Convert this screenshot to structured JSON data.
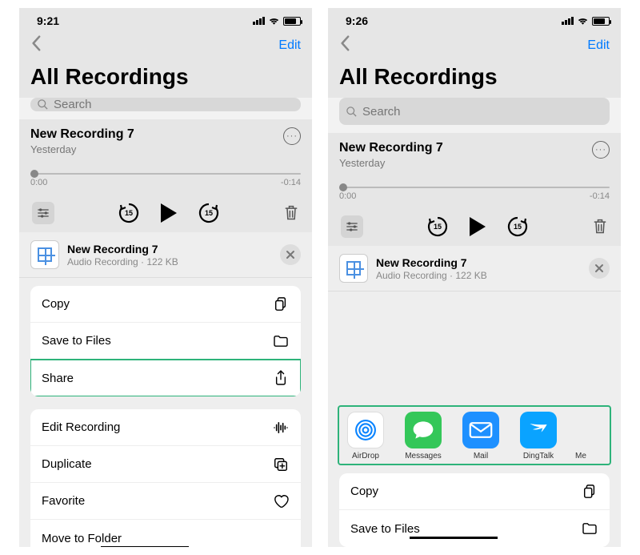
{
  "screens": {
    "left": {
      "status": {
        "time": "9:21"
      },
      "nav": {
        "edit": "Edit"
      },
      "title": "All Recordings",
      "search": {
        "placeholder": "Search"
      },
      "recording": {
        "title": "New Recording 7",
        "subtitle": "Yesterday",
        "start": "0:00",
        "end": "-0:14"
      },
      "share": {
        "title": "New Recording 7",
        "subtitle": "Audio Recording · 122 KB"
      },
      "actions": {
        "copy": "Copy",
        "savefiles": "Save to Files",
        "share": "Share",
        "edit": "Edit Recording",
        "duplicate": "Duplicate",
        "favorite": "Favorite",
        "movefolder": "Move to Folder"
      }
    },
    "right": {
      "status": {
        "time": "9:26"
      },
      "nav": {
        "edit": "Edit"
      },
      "title": "All Recordings",
      "search": {
        "placeholder": "Search"
      },
      "recording": {
        "title": "New Recording 7",
        "subtitle": "Yesterday",
        "start": "0:00",
        "end": "-0:14"
      },
      "share": {
        "title": "New Recording 7",
        "subtitle": "Audio Recording · 122 KB"
      },
      "apps": {
        "airdrop": "AirDrop",
        "messages": "Messages",
        "mail": "Mail",
        "dingtalk": "DingTalk",
        "more": "Me"
      },
      "actions": {
        "copy": "Copy",
        "savefiles": "Save to Files"
      }
    }
  },
  "skip_seconds": "15"
}
